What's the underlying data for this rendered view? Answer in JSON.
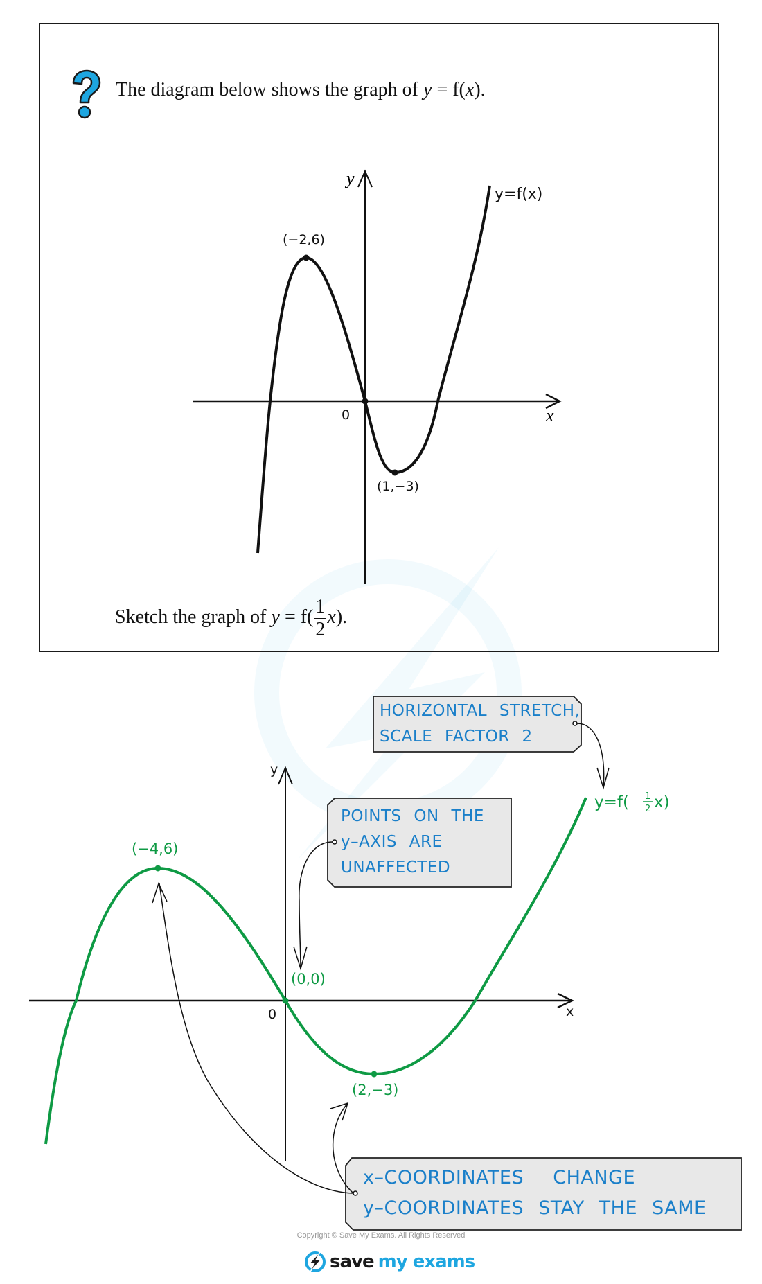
{
  "question": {
    "icon": "question-mark-icon",
    "intro_prefix": "The diagram below shows the graph of ",
    "intro_y": "y",
    "intro_eq": " = f(",
    "intro_x": "x",
    "intro_suffix": ").",
    "sketch_prefix": "Sketch the graph of ",
    "sketch_y": "y",
    "sketch_eq": " = f(",
    "sketch_frac_num": "1",
    "sketch_frac_den": "2",
    "sketch_x": "x",
    "sketch_suffix": ")."
  },
  "original_graph": {
    "y_axis_label": "y",
    "x_axis_label": "x",
    "origin_label": "0",
    "curve_label": "y=f(x)",
    "max_label": "(−2,6)",
    "min_label": "(1,−3)",
    "color": "#111111"
  },
  "transformed_graph": {
    "y_axis_label": "y",
    "x_axis_label": "x",
    "origin_label": "0",
    "curve_label_prefix": "y=f(",
    "curve_label_frac_num": "1",
    "curve_label_frac_den": "2",
    "curve_label_suffix": "x)",
    "max_label": "(−4,6)",
    "origin_point_label": "(0,0)",
    "min_label": "(2,−3)",
    "color": "#0e9a44"
  },
  "notes": {
    "stretch": [
      "HORIZONTAL STRETCH,",
      "SCALE FACTOR 2"
    ],
    "y_axis": [
      "POINTS ON THE",
      "y–AXIS ARE",
      "UNAFFECTED"
    ],
    "coordinates": [
      "x–COORDINATES  CHANGE",
      "y–COORDINATES STAY THE SAME"
    ],
    "text_color": "#1a7fc9",
    "box_fill": "#e8e8e8"
  },
  "chart_data": [
    {
      "type": "line",
      "title": "y = f(x)",
      "xlabel": "x",
      "ylabel": "y",
      "key_points": [
        {
          "x": -2,
          "y": 6,
          "label": "(−2,6)",
          "kind": "maximum"
        },
        {
          "x": 0,
          "y": 0,
          "label": "0",
          "kind": "origin"
        },
        {
          "x": 1,
          "y": -3,
          "label": "(1,−3)",
          "kind": "minimum"
        }
      ],
      "grid": false
    },
    {
      "type": "line",
      "title": "y = f(½x)",
      "xlabel": "x",
      "ylabel": "y",
      "key_points": [
        {
          "x": -4,
          "y": 6,
          "label": "(−4,6)",
          "kind": "maximum"
        },
        {
          "x": 0,
          "y": 0,
          "label": "(0,0)",
          "kind": "origin"
        },
        {
          "x": 2,
          "y": -3,
          "label": "(2,−3)",
          "kind": "minimum"
        }
      ],
      "grid": false
    }
  ],
  "footer": {
    "copyright": "Copyright © Save My Exams. All Rights Reserved",
    "logo_save": "save",
    "logo_myexams": "my exams"
  }
}
